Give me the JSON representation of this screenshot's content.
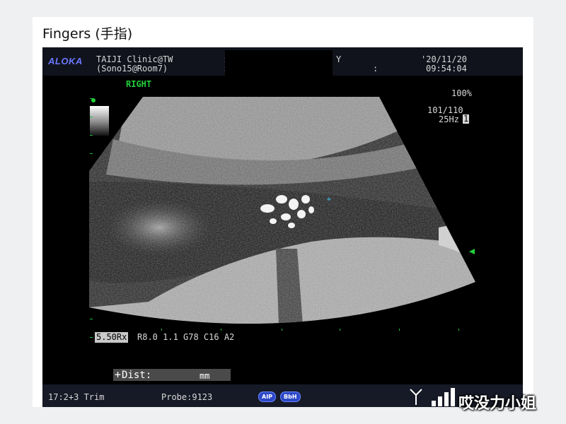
{
  "page_title": "Fingers (手指)",
  "header": {
    "brand": "ALOKA",
    "clinic_line1": "TAIJI Clinic@TW",
    "clinic_line2": "(Sono15@Room7)",
    "field_label": "Y",
    "colon": ":",
    "date": "'20/11/20",
    "time": "09:54:04"
  },
  "side_label": "RIGHT",
  "right_panel": {
    "gain": "100%",
    "frame_info": "101/110",
    "frame_rate": "25Hz",
    "frame_rate_flag": "1"
  },
  "params": {
    "scale": "5.50Rx",
    "settings": "R8.0 1.1 G78 C16 A2"
  },
  "measurement": {
    "label": "Dist:",
    "unit": "mm"
  },
  "footer": {
    "ga": "17:2+3 Trim",
    "probe": "Probe:9123",
    "badge_aip": "AIP",
    "badge_bbh": "BbH"
  },
  "watermark": "哎没力小姐",
  "colors": {
    "brand": "#6b78ff",
    "accent_green": "#22d03c",
    "badge": "#2d49c7"
  }
}
